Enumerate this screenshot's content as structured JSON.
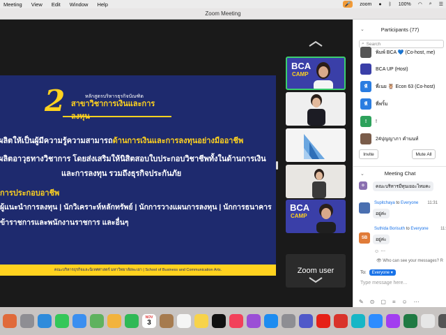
{
  "menubar": {
    "items": [
      "Meeting",
      "View",
      "Edit",
      "Window",
      "Help"
    ],
    "status": {
      "zoom_label": "zoom",
      "battery": "100%"
    }
  },
  "window": {
    "title": "Zoom Meeting"
  },
  "slide": {
    "big_number": "2",
    "subtitle": "หลักสูตรบริหารธุรกิจบัณฑิต",
    "title": "สาขาวิชาการเงินและการลงทุน",
    "line1_prefix": "ผลิตให้เป็นผู้มีความรู้ความสามารถ",
    "line1_highlight": "ด้านการเงินและการลงทุนอย่างมืออาชีพ",
    "line2": "ผลิตอาวุธทางวิชาการ โดยส่งเสริมให้นิสิตสอบใบประกอบวิชาชีพทั้งในด้านการเงิน",
    "line3": "และการลงทุน รวมถึงธุรกิจประกันภัย",
    "careers_heading": "การประกอบอาชีพ",
    "careers1": "ผู้แนะนำการลงทุน | นักวิเคราะห์หลักทรัพย์ | นักการวางแผนการลงทุน | นักการธนาคาร",
    "careers2": "ข้าราชการและพนักงานราชการ และอื่นๆ",
    "footer": "คณะบริหารธุรกิจและนิเทศศาสตร์ มหาวิทยาลัยพะเยา | School of Business and Communication Arts."
  },
  "thumbs": {
    "bca_title": "BCA",
    "bca_sub": "CAMP",
    "zoom_user": "Zoom user"
  },
  "participants": {
    "header": "Participants (77)",
    "search_placeholder": "Search",
    "items": [
      {
        "name": "พิมพ์ BCA 💙 (Co-host, me)",
        "avatar": "",
        "color": "#555555"
      },
      {
        "name": "BCA UP (Host)",
        "avatar": "",
        "color": "#3a3fa8"
      },
      {
        "name": "พี่เนย 🦉 Econ 63 (Co-host)",
        "avatar": "พี",
        "color": "#2a7de1"
      },
      {
        "name": "พี่พริ้ม",
        "avatar": "พี",
        "color": "#2a7de1"
      },
      {
        "name": "!",
        "avatar": "!",
        "color": "#2ea25c"
      },
      {
        "name": "24ปุญญาภา คำนนท์",
        "avatar": "",
        "color": "#7a5c4a"
      }
    ],
    "invite_label": "Invite",
    "mute_all_label": "Mute All"
  },
  "chat": {
    "header": "Meeting Chat",
    "messages": [
      {
        "sender": "",
        "to": "",
        "time": "",
        "text": "คณะบริหารมีทุนเยอะไหมคะ",
        "avatar": "o"
      },
      {
        "sender": "Supitchaya",
        "to": "Everyone",
        "time": "11:31",
        "text": "อยู่ค่ะ"
      },
      {
        "sender": "Suthida Borisuth",
        "to": "Everyone",
        "time": "11:",
        "text": "อยู่ค่ะ",
        "avatar": "SB"
      }
    ],
    "who_can_see": "Who can see your messages? R",
    "to_label": "To:",
    "to_value": "Everyone",
    "placeholder": "Type message here..."
  },
  "dock": {
    "calendar_month": "NOV",
    "calendar_day": "3",
    "apps": [
      "finder",
      "launchpad",
      "safari",
      "messages",
      "mail",
      "maps",
      "photos",
      "facetime",
      "calendar",
      "contacts",
      "reminders",
      "notes",
      "tv",
      "music",
      "podcasts",
      "appstore",
      "settings",
      "teams",
      "youtube",
      "photobooth",
      "canva",
      "zoom",
      "messenger",
      "excel",
      "keyboard",
      "preview"
    ]
  },
  "colors": {
    "slide_bg": "#1e2a6e",
    "accent_yellow": "#ffd21f",
    "active_speaker": "#3ccf6e",
    "link_blue": "#1a73e8"
  }
}
